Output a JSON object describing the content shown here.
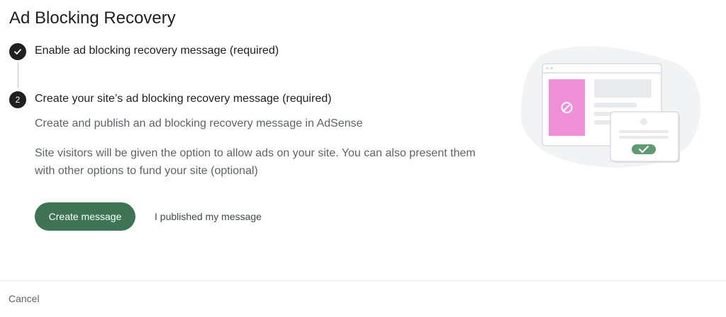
{
  "header": {
    "title": "Ad Blocking Recovery"
  },
  "steps": [
    {
      "marker": "",
      "title": "Enable ad blocking recovery message (required)",
      "state": "completed"
    },
    {
      "marker": "2",
      "title": "Create your site’s ad blocking recovery message (required)",
      "state": "current"
    }
  ],
  "content": {
    "description": "Create and publish an ad blocking recovery message in AdSense",
    "details": "Site visitors will be given the option to allow ads on your site. You can also present them with other options to fund your site (optional)"
  },
  "actions": {
    "create_label": "Create message",
    "published_label": "I published my message"
  },
  "footer": {
    "cancel_label": "Cancel"
  },
  "colors": {
    "primary_button": "#3e7454",
    "step_circle": "#1f1f1f",
    "ad_block_panel": "#ee8fd8",
    "check_badge": "#5e9a72"
  },
  "icons": {
    "step1": "checkmark-icon",
    "illustration_blocked": "no-entry-icon",
    "illustration_check": "checkmark-icon"
  }
}
